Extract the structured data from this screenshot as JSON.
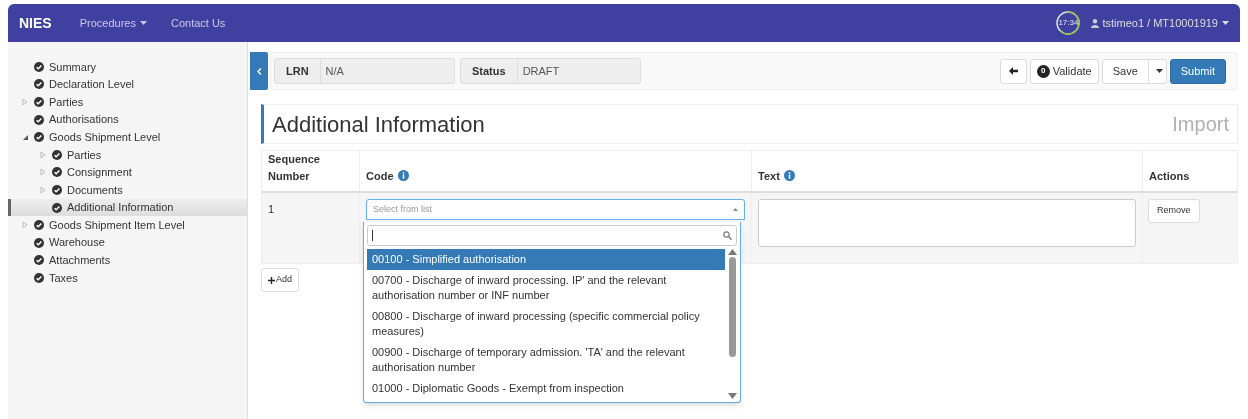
{
  "navbar": {
    "brand": "NIES",
    "menu": [
      {
        "label": "Procedures",
        "dropdown": true
      },
      {
        "label": "Contact Us",
        "dropdown": false
      }
    ],
    "timer": "17:34",
    "user": "tstimeo1 / MT10001919"
  },
  "sidebar": {
    "items": [
      {
        "label": "Summary",
        "kind": "leaf",
        "selected": false
      },
      {
        "label": "Declaration Level",
        "kind": "leaf",
        "selected": false
      },
      {
        "label": "Parties",
        "kind": "branch",
        "expanded": false,
        "selected": false
      },
      {
        "label": "Authorisations",
        "kind": "leaf",
        "selected": false
      },
      {
        "label": "Goods Shipment Level",
        "kind": "branch",
        "expanded": true,
        "selected": false,
        "children": [
          {
            "label": "Parties",
            "kind": "branch",
            "expanded": false,
            "selected": false
          },
          {
            "label": "Consignment",
            "kind": "branch",
            "expanded": false,
            "selected": false
          },
          {
            "label": "Documents",
            "kind": "branch",
            "expanded": false,
            "selected": false
          },
          {
            "label": "Additional Information",
            "kind": "leaf",
            "selected": true
          }
        ]
      },
      {
        "label": "Goods Shipment Item Level",
        "kind": "branch",
        "expanded": false,
        "selected": false
      },
      {
        "label": "Warehouse",
        "kind": "leaf",
        "selected": false
      },
      {
        "label": "Attachments",
        "kind": "leaf",
        "selected": false
      },
      {
        "label": "Taxes",
        "kind": "leaf",
        "selected": false
      }
    ]
  },
  "header": {
    "fields": [
      {
        "label": "LRN",
        "value": "N/A"
      },
      {
        "label": "Status",
        "value": "DRAFT"
      }
    ],
    "validate_count": "0",
    "buttons": {
      "validate": "Validate",
      "save": "Save",
      "submit": "Submit"
    }
  },
  "title": "Additional Information",
  "subtitle": "Import",
  "table": {
    "columns": [
      "Sequence Number",
      "Code",
      "Text",
      "Actions"
    ],
    "rows": [
      {
        "sequence": "1",
        "code_placeholder": "Select from list",
        "action": "Remove"
      }
    ]
  },
  "add_button": "Add",
  "dropdown": {
    "options": [
      {
        "label": "00100 - Simplified authorisation",
        "selected": true
      },
      {
        "label": "00700 - Discharge of inward processing. IP' and the relevant authorisation number or INF number",
        "selected": false
      },
      {
        "label": "00800 - Discharge of inward processing (specific commercial policy measures)",
        "selected": false
      },
      {
        "label": "00900 - Discharge of temporary admission. 'TA' and the relevant authorisation number",
        "selected": false
      },
      {
        "label": "01000 - Diplomatic Goods - Exempt from inspection",
        "selected": false
      }
    ]
  }
}
